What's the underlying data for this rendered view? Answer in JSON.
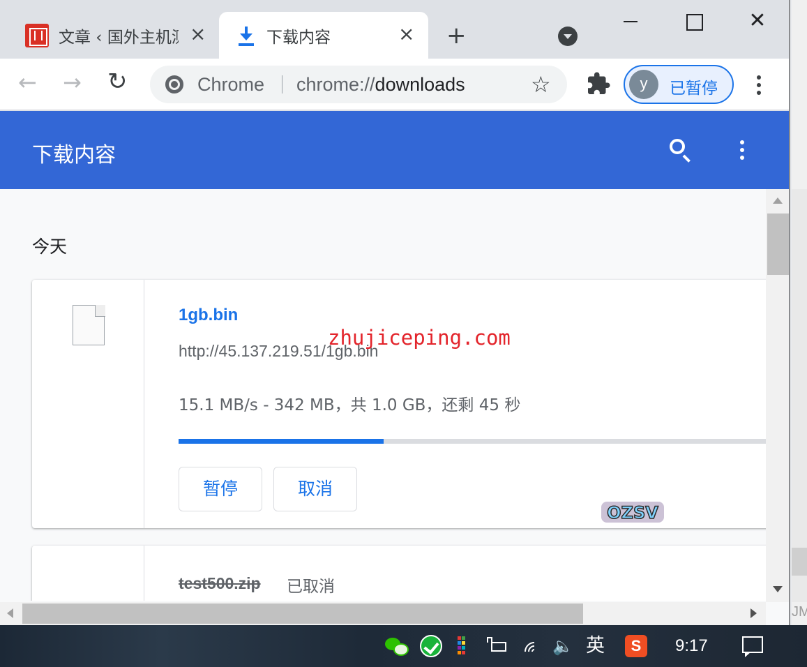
{
  "tabs": [
    {
      "title": "文章 ‹ 国外主机测评",
      "close_icon": "×"
    },
    {
      "title": "下载内容",
      "close_icon": "×"
    }
  ],
  "tabstrip": {
    "new_tab": "+"
  },
  "window_controls": {
    "close": "✕"
  },
  "toolbar": {
    "back": "←",
    "forward": "→",
    "reload": "↻",
    "omnibox_label": "Chrome",
    "url_scheme": "chrome://",
    "url_host": "downloads",
    "bookmark_star": "☆",
    "profile_initial": "y",
    "profile_status": "已暂停"
  },
  "page": {
    "title": "下载内容",
    "date_group": "今天",
    "downloads": [
      {
        "file_name": "1gb.bin",
        "url": "http://45.137.219.51/1gb.bin",
        "status": "15.1 MB/s - 342 MB，共 1.0 GB，还剩 45 秒",
        "progress_fraction": 0.342,
        "pause_label": "暂停",
        "cancel_label": "取消"
      },
      {
        "file_name": "test500.zip",
        "status": "已取消"
      }
    ]
  },
  "watermarks": {
    "site": "zhujiceping.com",
    "logo": "OZSV"
  },
  "background_window": {
    "text": "JM"
  },
  "taskbar": {
    "ime": "英",
    "sogou": "S",
    "sound": "🔈",
    "clock": "9:17"
  },
  "colors": {
    "header_blue": "#3367d6",
    "accent_blue": "#1a73e8",
    "watermark_red": "#e3242b"
  }
}
